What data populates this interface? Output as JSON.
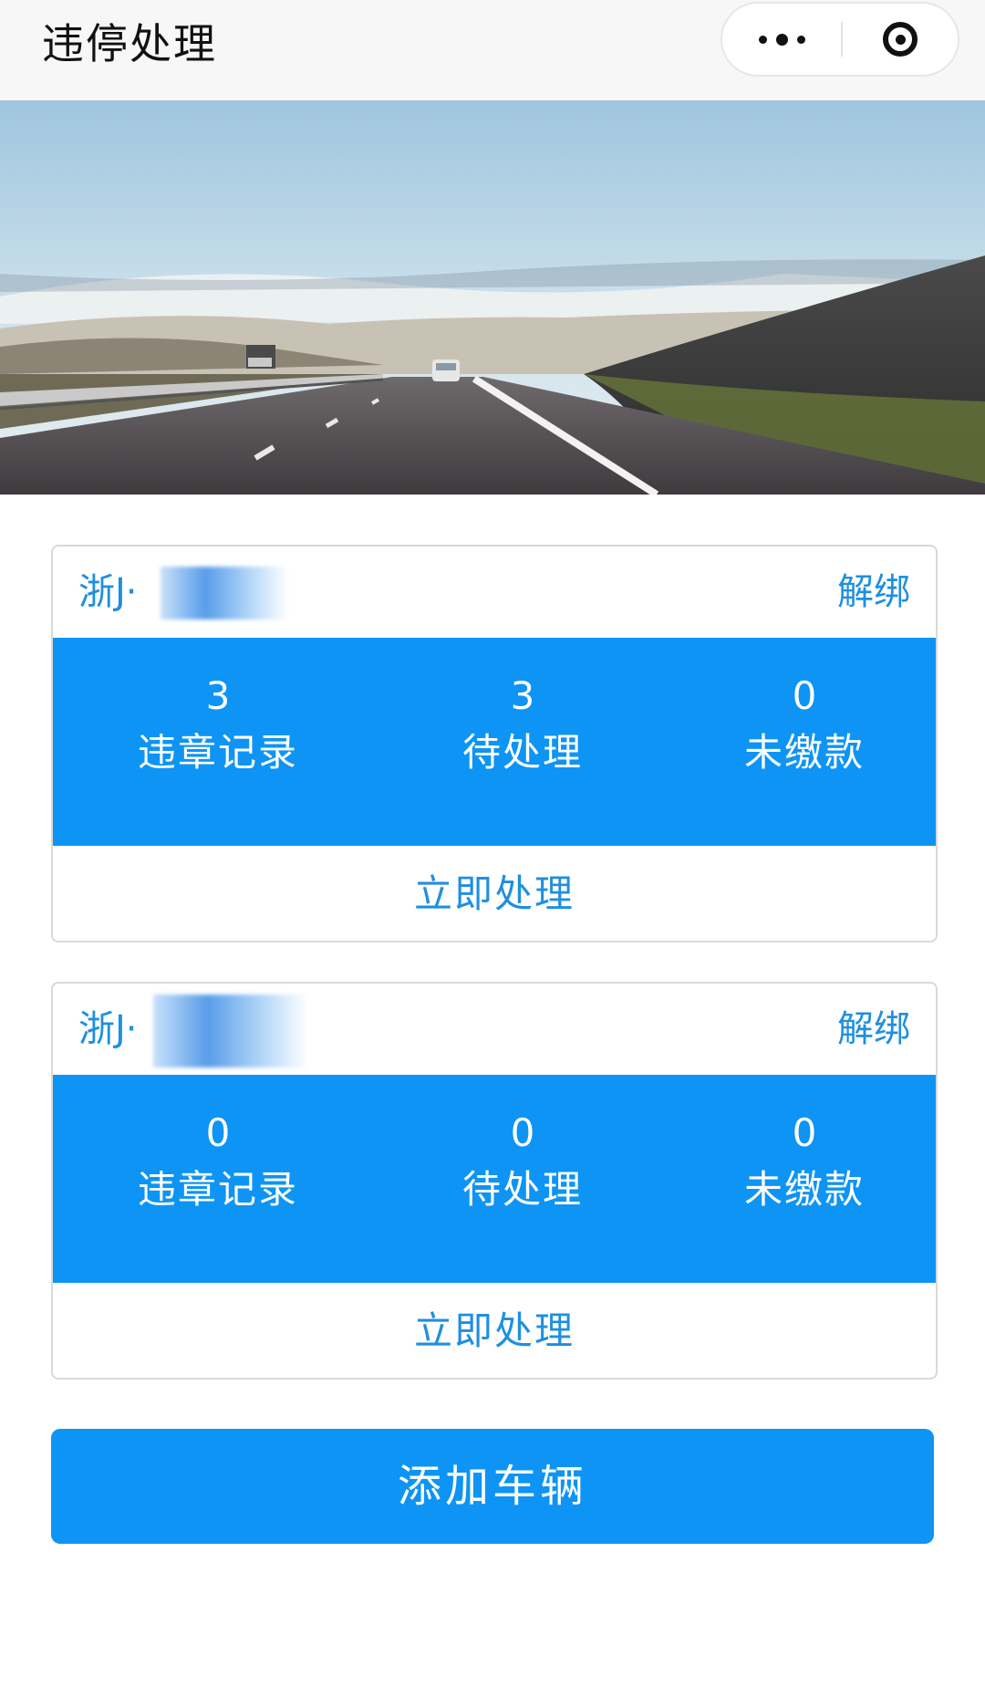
{
  "navbar": {
    "title": "违停处理"
  },
  "vehicles": [
    {
      "plate": "浙J·",
      "unbind_label": "解绑",
      "stats": [
        {
          "value": "3",
          "label": "违章记录"
        },
        {
          "value": "3",
          "label": "待处理"
        },
        {
          "value": "0",
          "label": "未缴款"
        }
      ],
      "action_label": "立即处理"
    },
    {
      "plate": "浙J·",
      "unbind_label": "解绑",
      "stats": [
        {
          "value": "0",
          "label": "违章记录"
        },
        {
          "value": "0",
          "label": "待处理"
        },
        {
          "value": "0",
          "label": "未缴款"
        }
      ],
      "action_label": "立即处理"
    }
  ],
  "add_button_label": "添加车辆",
  "colors": {
    "accent": "#0d94f5",
    "link": "#1f8fe0",
    "card_border": "#d9d9d9",
    "navbar_bg": "#f7f7f7"
  },
  "icons": {
    "more": "more-dots-icon",
    "close": "miniprogram-close-icon"
  }
}
